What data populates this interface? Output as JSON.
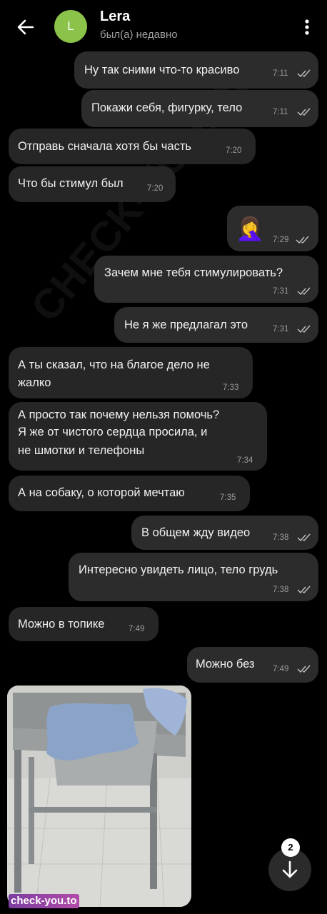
{
  "header": {
    "back_icon": "arrow-left-icon",
    "avatar_letter": "L",
    "avatar_color": "#8bc34a",
    "name": "Lera",
    "status": "был(а) недавно",
    "menu_icon": "more-vertical-icon"
  },
  "messages": [
    {
      "dir": "out",
      "text": "Ну так сними что-то красиво",
      "time": "7:11",
      "read": true
    },
    {
      "dir": "out",
      "text": "Покажи себя, фигурку, тело",
      "time": "7:11",
      "read": true
    },
    {
      "dir": "in",
      "text": "Отправь сначала хотя бы часть",
      "time": "7:20"
    },
    {
      "dir": "in",
      "text": "Что бы стимул был",
      "time": "7:20"
    },
    {
      "dir": "out",
      "text": "🤦‍♀️",
      "time": "7:29",
      "read": true
    },
    {
      "dir": "out",
      "text": "Зачем мне тебя стимулировать?",
      "time": "7:31",
      "read": true
    },
    {
      "dir": "out",
      "text": "Не я же предлагал это",
      "time": "7:31",
      "read": true
    },
    {
      "dir": "in",
      "lines": [
        "А ты сказал, что на благое дело не",
        "жалко"
      ],
      "time": "7:33"
    },
    {
      "dir": "in",
      "lines": [
        "А просто так почему нельзя помочь?",
        "Я же от чистого  сердца просила, и",
        "не шмотки и телефоны"
      ],
      "time": "7:34"
    },
    {
      "dir": "in",
      "text": "А на собаку, о которой мечтаю",
      "time": "7:35"
    },
    {
      "dir": "out",
      "text": "В общем жду видео",
      "time": "7:38",
      "read": true
    },
    {
      "dir": "out",
      "text": "Интересно увидеть лицо, тело грудь",
      "time": "7:38",
      "read": true
    },
    {
      "dir": "in",
      "text": "Можно в топике",
      "time": "7:49"
    },
    {
      "dir": "out",
      "text": "Можно без",
      "time": "7:49",
      "read": true
    }
  ],
  "photo": {
    "description_icon": "photo-attachment"
  },
  "scroll_down": {
    "icon": "arrow-down-icon",
    "unread_count": "2"
  },
  "watermark": {
    "corner": "check-you.to",
    "diagonal": "CHECK-YOU.ME"
  }
}
